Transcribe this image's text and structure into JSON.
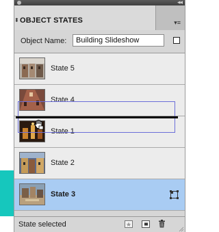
{
  "panel": {
    "title": "OBJECT STATES",
    "collapse_glyph": "◂◂",
    "menu_glyph": "▾≡"
  },
  "object_name": {
    "label": "Object Name:",
    "value": "Building Slideshow"
  },
  "states": [
    {
      "label": "State 5",
      "selected": false
    },
    {
      "label": "State 4",
      "selected": false
    },
    {
      "label": "State 1",
      "selected": false
    },
    {
      "label": "State 2",
      "selected": false
    },
    {
      "label": "State 3",
      "selected": true
    }
  ],
  "status": {
    "text": "State selected",
    "icons": [
      "new-state-icon",
      "duplicate-state-icon",
      "delete-state-icon"
    ]
  },
  "colors": {
    "selected_row": "#a9ccf3",
    "drag_outline": "#6b6ed8",
    "accent_strip": "#16c7bd"
  }
}
